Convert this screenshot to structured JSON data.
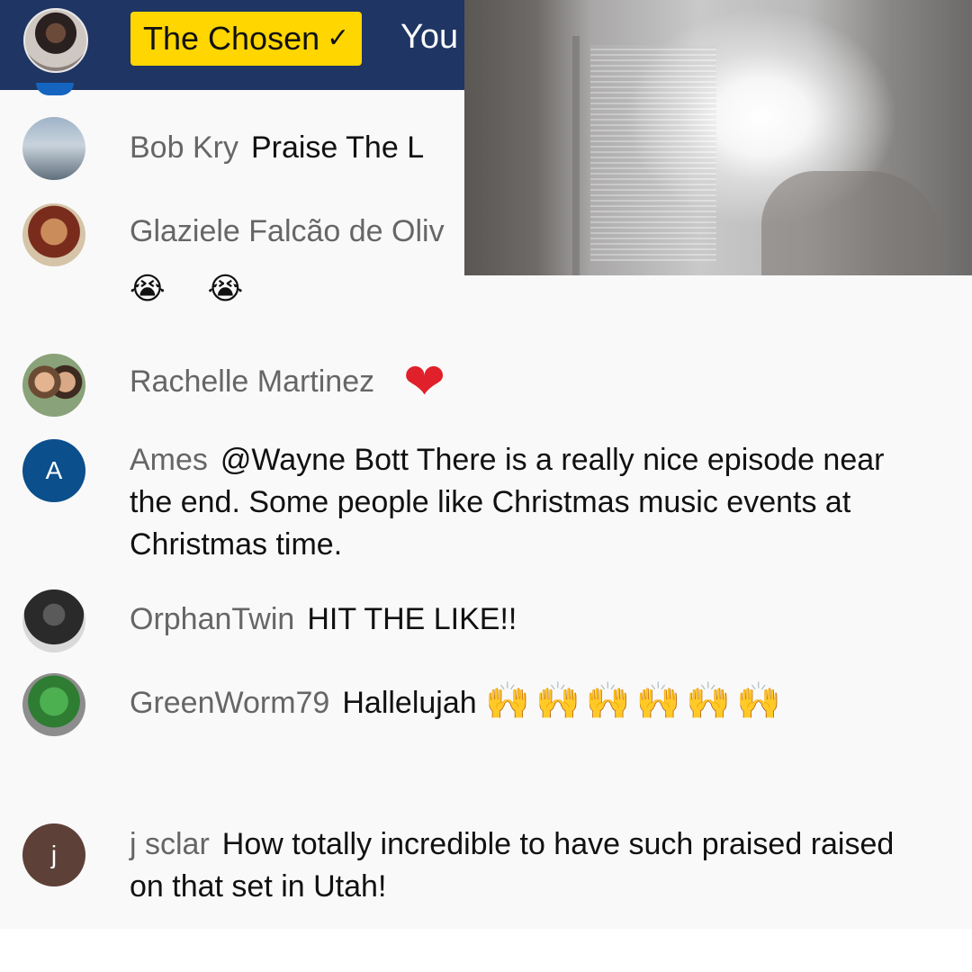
{
  "header": {
    "channel_name": "The Chosen",
    "verified_icon": "check-icon",
    "message_partial": "You",
    "colors": {
      "bar": "#1f3563",
      "badge": "#ffd600"
    }
  },
  "messages": [
    {
      "author": "Bob Kry",
      "text": "Praise The L"
    },
    {
      "author": "Glaziele Falcão de Oliv",
      "text": "😭 😭"
    },
    {
      "author": "Rachelle Martinez",
      "text": "❤"
    },
    {
      "author": "Ames",
      "avatar_letter": "A",
      "avatar_color": "#0b4f8c",
      "text": "@Wayne Bott There is a really nice episode near the end. Some people like Christmas music events at Christmas time."
    },
    {
      "author": "OrphanTwin",
      "text": "HIT THE LIKE!!"
    },
    {
      "author": "GreenWorm79",
      "text": "Hallelujah",
      "emoji": "🙌🙌🙌🙌🙌🙌"
    },
    {
      "author": "j sclar",
      "avatar_letter": "j",
      "avatar_color": "#5d4037",
      "text": "How totally incredible to have such praised raised on that set in Utah!"
    }
  ],
  "video_overlay": {
    "content": "backlit figure in a doorway"
  }
}
